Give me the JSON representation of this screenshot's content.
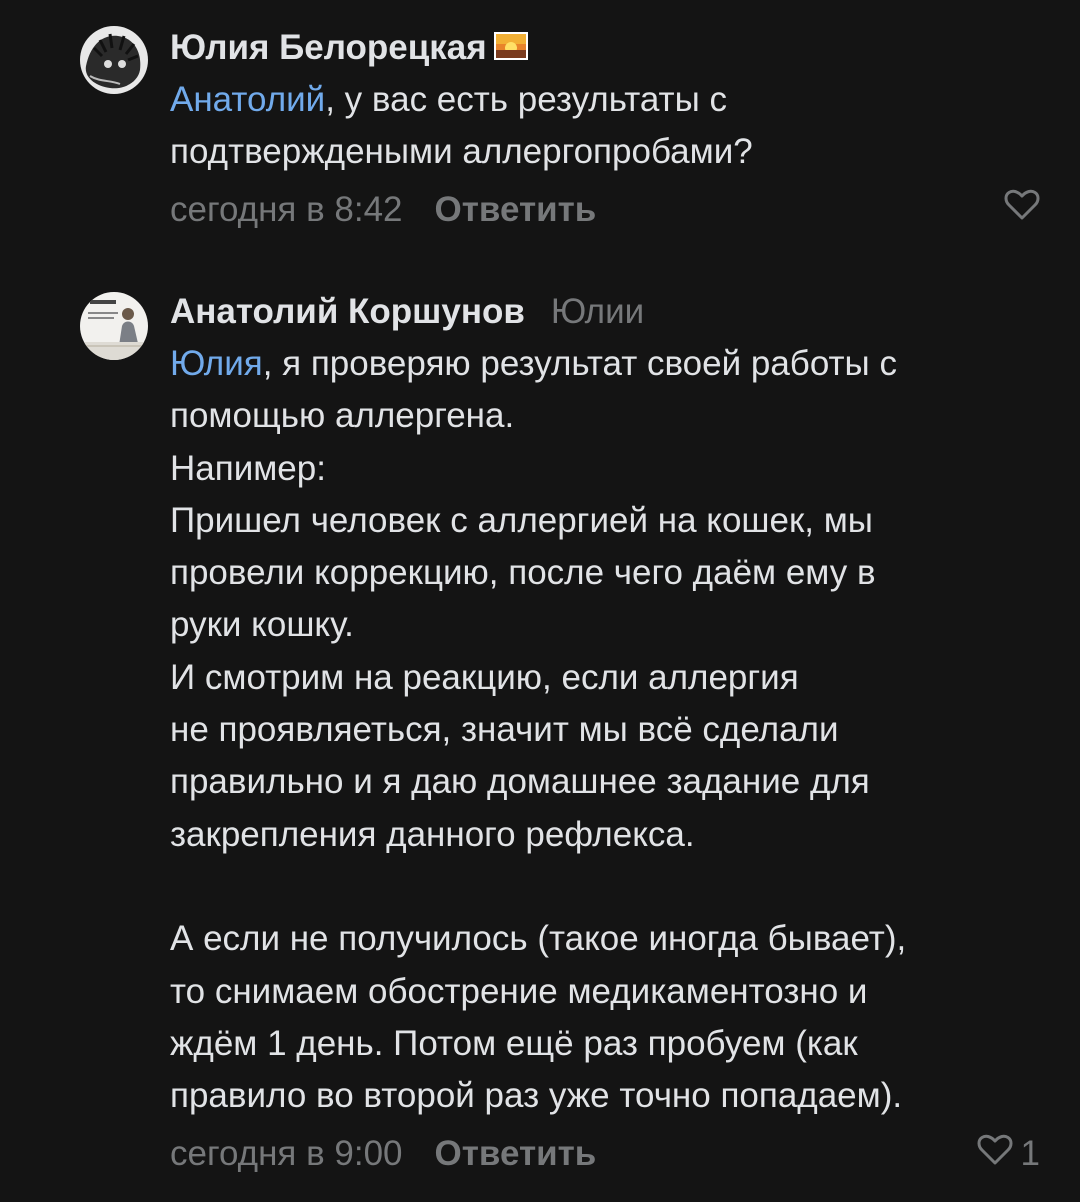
{
  "comments": [
    {
      "author": "Юлия Белорецкая",
      "reply_to": "",
      "mention": "Анатолий",
      "first_line_rest": ", у вас есть результаты с",
      "lines": [
        "подтверждеными аллергопробами?"
      ],
      "time": "сегодня в 8:42",
      "reply_label": "Ответить",
      "likes": ""
    },
    {
      "author": "Анатолий Коршунов",
      "reply_to": "Юлии",
      "mention": "Юлия",
      "first_line_rest": ", я проверяю результат своей работы с",
      "lines": [
        "помощью аллергена.",
        "Напимер:",
        "Пришел человек с аллергией на кошек, мы",
        "провели коррекцию, после чего даём ему в",
        "руки кошку.",
        "И смотрим на реакцию, если аллергия",
        "не проявляеться, значит мы всё сделали",
        "правильно и я даю домашнее задание для",
        "закрепления данного рефлекса.",
        "",
        "А если не получилось (такое иногда бывает),",
        "то снимаем обострение медикаментозно и",
        "ждём 1 день. Потом ещё раз пробуем (как",
        "правило во второй раз уже точно попадаем)."
      ],
      "time": "сегодня в 9:00",
      "reply_label": "Ответить",
      "likes": "1"
    }
  ],
  "colors": {
    "background": "#141414",
    "text": "#e1e3e6",
    "secondary": "#76787a",
    "link": "#71aaeb"
  },
  "icons": {
    "flag": "sunset-emoji-icon",
    "like": "heart-outline-icon"
  }
}
